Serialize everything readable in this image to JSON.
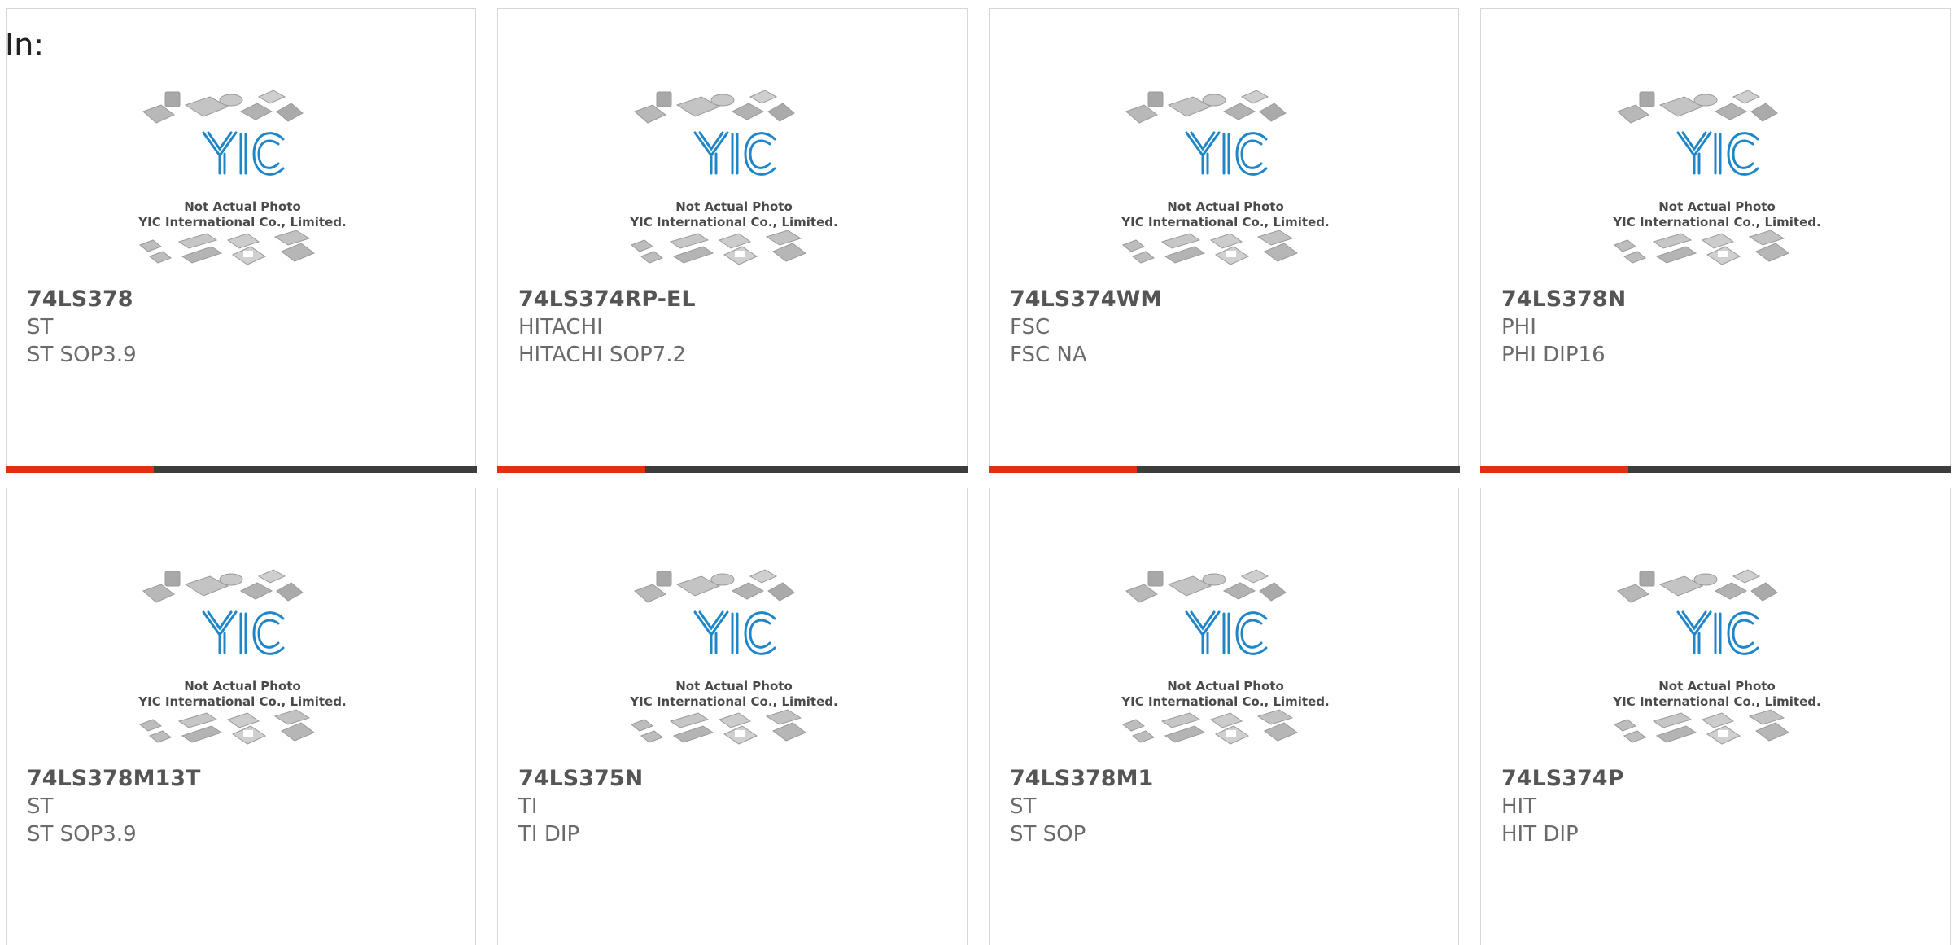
{
  "header": {
    "in_label": "In:"
  },
  "placeholder": {
    "caption_line1": "Not Actual Photo",
    "caption_line2": "YIC International Co., Limited.",
    "logo_text": "YIC"
  },
  "colors": {
    "accent": "#e2300f",
    "bar_dark": "#3d3d3d",
    "logo_blue": "#1f86c8"
  },
  "products": [
    {
      "part_number": "74LS378",
      "brand": "ST",
      "package": "ST SOP3.9"
    },
    {
      "part_number": "74LS374RP-EL",
      "brand": "HITACHI",
      "package": "HITACHI SOP7.2"
    },
    {
      "part_number": "74LS374WM",
      "brand": "FSC",
      "package": "FSC NA"
    },
    {
      "part_number": "74LS378N",
      "brand": "PHI",
      "package": "PHI DIP16"
    },
    {
      "part_number": "74LS378M13T",
      "brand": "ST",
      "package": "ST SOP3.9"
    },
    {
      "part_number": "74LS375N",
      "brand": "TI",
      "package": "TI DIP"
    },
    {
      "part_number": "74LS378M1",
      "brand": "ST",
      "package": "ST SOP"
    },
    {
      "part_number": "74LS374P",
      "brand": "HIT",
      "package": "HIT DIP"
    }
  ]
}
